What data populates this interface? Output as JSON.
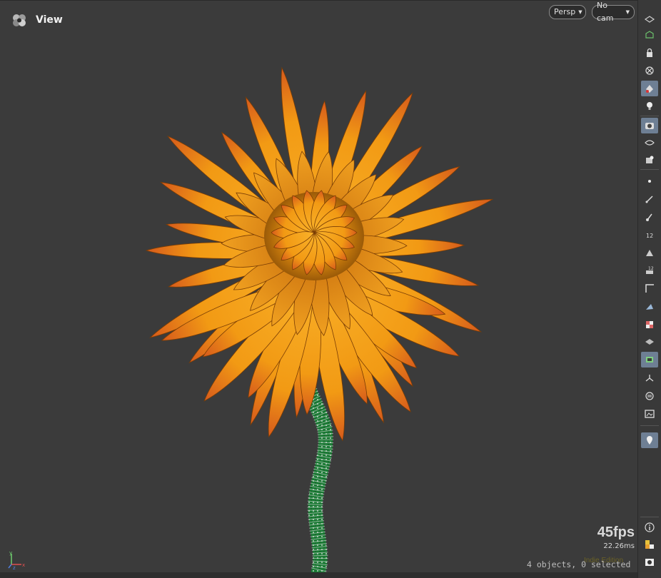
{
  "viewport": {
    "title": "View",
    "persp_label": "Persp",
    "camera_label": "No cam",
    "fps": "45fps",
    "frame_time": "22.26ms",
    "status": "4 objects, 0 selected",
    "watermark": "Indie Edition",
    "axis_labels": [
      "y",
      "x",
      "z"
    ]
  },
  "toolbar": {
    "icons": [
      "display-options-icon",
      "ghost-icon",
      "lock-icon",
      "xray-icon",
      "shading-icon",
      "light-icon",
      "camera-icon",
      "visibility-icon",
      "snapshot-icon",
      "point-icon",
      "edge-icon",
      "normal-icon",
      "number-display-icon",
      "template-icon",
      "overlay-display-icon",
      "corner-icon",
      "wire-icon",
      "texture-icon",
      "layers-icon",
      "background-icon",
      "scale-icon",
      "guide-icon",
      "frame-icon",
      "pin-icon",
      "info-icon",
      "palette-icon",
      "eye-icon"
    ]
  },
  "colors": {
    "background": "#3b3b3b",
    "petal": "#f5a21c",
    "petal_tip": "#d9541c",
    "stem": "#1e8a3a",
    "active_button": "#6e7f94"
  }
}
